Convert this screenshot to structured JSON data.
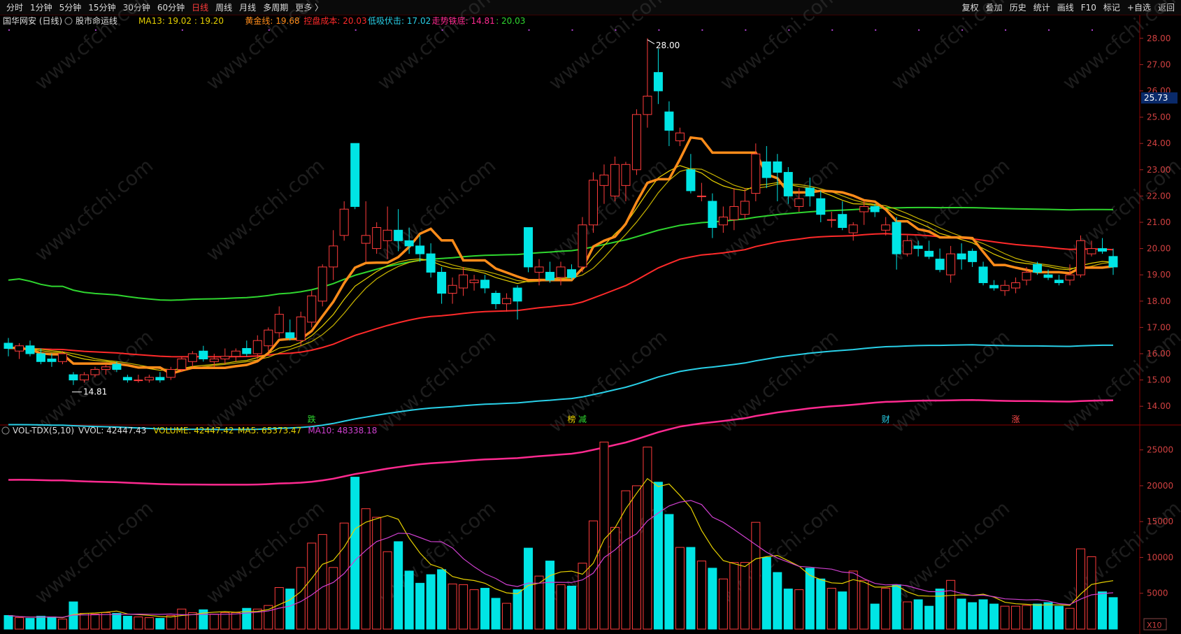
{
  "toolbar": {
    "periods": [
      "分时",
      "1分钟",
      "5分钟",
      "15分钟",
      "30分钟",
      "60分钟",
      "日线",
      "周线",
      "月线",
      "多周期",
      "更多 〉"
    ],
    "active_period": "日线",
    "tools": [
      "复权",
      "叠加",
      "历史",
      "统计",
      "画线",
      "F10",
      "标记",
      "+自选",
      "返回"
    ]
  },
  "main_header": {
    "stock": "国华网安 (日线)",
    "indicator": "股市命运线",
    "items": [
      {
        "label": "MA13: 19.02 : 19.20",
        "color": "#e6d000"
      },
      {
        "label": "黄金线: 19.68",
        "color": "#ff8c1a"
      },
      {
        "label": "控盘成本: 20.03",
        "color": "#ff2a2a"
      },
      {
        "label": "低吸伏击: 17.02",
        "color": "#29d0e8"
      },
      {
        "label": "走势铁底: 14.81",
        "color": "#ff2a90"
      },
      {
        "label": ": 20.03",
        "color": "#2fd62f"
      }
    ]
  },
  "vol_header": {
    "name": "VOL-TDX(5,10)",
    "items": [
      {
        "label": "VVOL: 42447.43",
        "color": "#dddddd"
      },
      {
        "label": "VOLUME: 42447.42",
        "color": "#e6d000"
      },
      {
        "label": "MA5: 65373.47",
        "color": "#e6d000"
      },
      {
        "label": "MA10: 48338.18",
        "color": "#d040d0"
      }
    ]
  },
  "price_axis": [
    "28.00",
    "27.00",
    "26.00",
    "25.00",
    "24.00",
    "23.00",
    "22.00",
    "21.00",
    "20.00",
    "19.00",
    "18.00",
    "17.00",
    "16.00",
    "15.00",
    "14.00"
  ],
  "vol_axis": [
    "25000",
    "20000",
    "15000",
    "10000",
    "5000"
  ],
  "vol_unit": "X10",
  "current_price": "25.73",
  "annotations": {
    "high": "28.00",
    "low": "14.81"
  },
  "events": [
    {
      "text": "跌",
      "index": 28,
      "color": "#2fd62f"
    },
    {
      "text": "榜",
      "index": 52,
      "color": "#e6d000"
    },
    {
      "text": "减",
      "index": 53,
      "color": "#2fd62f"
    },
    {
      "text": "财",
      "index": 81,
      "color": "#29d0e8"
    },
    {
      "text": "涨",
      "index": 93,
      "color": "#ff4a4a"
    }
  ],
  "watermark": "www.cfchi.com",
  "colors": {
    "up": "#ff3c3c",
    "down": "#00e5e5",
    "ma13a": "#e6d000",
    "ma13b": "#e6d000",
    "gold": "#ff8c1a",
    "cost": "#ff2a2a",
    "ambush": "#29d0e8",
    "bottom": "#ff2a90",
    "green": "#2fd62f",
    "vma5": "#e6d000",
    "vma10": "#d040d0"
  },
  "chart_data": {
    "type": "candlestick",
    "candles": [
      [
        16.4,
        16.6,
        15.9,
        16.2
      ],
      [
        16.1,
        16.4,
        15.8,
        16.3
      ],
      [
        16.3,
        16.5,
        15.9,
        16.0
      ],
      [
        16.0,
        16.2,
        15.6,
        15.7
      ],
      [
        15.8,
        16.0,
        15.5,
        15.7
      ],
      [
        15.7,
        16.1,
        15.6,
        16.0
      ],
      [
        15.2,
        15.3,
        14.81,
        15.0
      ],
      [
        15.0,
        15.3,
        14.9,
        15.2
      ],
      [
        15.2,
        15.5,
        15.1,
        15.4
      ],
      [
        15.4,
        15.6,
        15.2,
        15.5
      ],
      [
        15.6,
        15.7,
        15.3,
        15.4
      ],
      [
        15.1,
        15.2,
        14.9,
        15.0
      ],
      [
        15.0,
        15.2,
        14.9,
        15.0
      ],
      [
        15.0,
        15.2,
        14.9,
        15.1
      ],
      [
        15.1,
        15.3,
        14.9,
        15.0
      ],
      [
        15.1,
        15.5,
        15.0,
        15.4
      ],
      [
        15.4,
        15.9,
        15.3,
        15.8
      ],
      [
        15.7,
        16.1,
        15.5,
        16.0
      ],
      [
        16.1,
        16.3,
        15.7,
        15.8
      ],
      [
        15.7,
        16.0,
        15.5,
        15.8
      ],
      [
        15.8,
        16.2,
        15.6,
        15.9
      ],
      [
        15.9,
        16.2,
        15.7,
        16.1
      ],
      [
        16.2,
        16.5,
        15.9,
        16.0
      ],
      [
        16.0,
        16.7,
        15.8,
        16.5
      ],
      [
        16.3,
        17.0,
        16.1,
        16.9
      ],
      [
        16.8,
        17.8,
        16.6,
        17.5
      ],
      [
        16.8,
        17.3,
        16.5,
        16.6
      ],
      [
        16.5,
        17.6,
        16.3,
        17.4
      ],
      [
        17.2,
        18.4,
        17.0,
        18.2
      ],
      [
        18.0,
        19.4,
        17.8,
        19.3
      ],
      [
        19.3,
        20.7,
        18.8,
        20.1
      ],
      [
        20.5,
        21.8,
        20.3,
        21.5
      ],
      [
        24.0,
        24.0,
        21.5,
        21.6
      ],
      [
        20.2,
        21.8,
        19.5,
        20.5
      ],
      [
        20.0,
        21.0,
        19.8,
        20.8
      ],
      [
        20.3,
        21.6,
        19.6,
        20.7
      ],
      [
        20.7,
        21.5,
        19.9,
        20.3
      ],
      [
        20.3,
        20.8,
        19.8,
        20.1
      ],
      [
        20.1,
        20.5,
        19.5,
        19.8
      ],
      [
        19.8,
        20.2,
        18.9,
        19.1
      ],
      [
        19.1,
        19.3,
        17.9,
        18.3
      ],
      [
        18.3,
        18.9,
        17.9,
        18.6
      ],
      [
        18.5,
        19.3,
        18.2,
        19.0
      ],
      [
        18.7,
        19.0,
        18.4,
        18.8
      ],
      [
        18.8,
        19.0,
        18.3,
        18.5
      ],
      [
        18.3,
        18.4,
        17.7,
        17.9
      ],
      [
        17.9,
        18.3,
        17.6,
        18.1
      ],
      [
        18.5,
        18.6,
        17.3,
        18.0
      ],
      [
        20.8,
        20.8,
        19.1,
        19.3
      ],
      [
        19.1,
        19.6,
        18.6,
        19.3
      ],
      [
        19.1,
        19.5,
        18.7,
        18.8
      ],
      [
        18.9,
        19.5,
        18.6,
        19.3
      ],
      [
        19.2,
        19.4,
        18.8,
        18.9
      ],
      [
        19.3,
        21.2,
        19.1,
        20.9
      ],
      [
        20.9,
        22.9,
        20.6,
        22.6
      ],
      [
        22.4,
        23.2,
        21.7,
        22.8
      ],
      [
        22.0,
        23.5,
        21.8,
        23.2
      ],
      [
        22.4,
        23.3,
        21.8,
        23.2
      ],
      [
        23.0,
        25.3,
        22.8,
        25.1
      ],
      [
        25.1,
        28.0,
        24.6,
        25.8
      ],
      [
        26.7,
        27.6,
        25.5,
        26.0
      ],
      [
        25.2,
        25.6,
        23.9,
        24.5
      ],
      [
        24.1,
        24.6,
        23.9,
        24.4
      ],
      [
        23.0,
        23.6,
        22.1,
        22.2
      ],
      [
        22.0,
        22.5,
        21.8,
        22.0
      ],
      [
        21.8,
        22.1,
        20.4,
        20.8
      ],
      [
        20.9,
        21.6,
        20.6,
        21.2
      ],
      [
        21.1,
        22.3,
        20.7,
        21.6
      ],
      [
        21.3,
        22.3,
        21.1,
        21.8
      ],
      [
        22.1,
        24.0,
        21.8,
        23.6
      ],
      [
        23.3,
        23.9,
        22.3,
        22.7
      ],
      [
        23.3,
        23.6,
        21.8,
        22.9
      ],
      [
        22.9,
        23.1,
        21.7,
        22.0
      ],
      [
        21.6,
        22.3,
        21.4,
        21.9
      ],
      [
        22.3,
        22.7,
        21.6,
        22.0
      ],
      [
        21.9,
        22.2,
        21.0,
        21.3
      ],
      [
        21.1,
        21.4,
        20.8,
        21.1
      ],
      [
        21.3,
        21.8,
        20.7,
        20.8
      ],
      [
        20.6,
        21.0,
        20.3,
        20.9
      ],
      [
        21.4,
        21.8,
        20.9,
        21.6
      ],
      [
        21.6,
        21.7,
        21.2,
        21.4
      ],
      [
        20.7,
        21.2,
        20.5,
        20.9
      ],
      [
        21.0,
        21.2,
        19.2,
        19.8
      ],
      [
        19.8,
        20.5,
        19.7,
        20.3
      ],
      [
        20.1,
        20.3,
        19.7,
        20.0
      ],
      [
        19.9,
        20.3,
        19.6,
        19.7
      ],
      [
        19.6,
        20.0,
        19.1,
        19.2
      ],
      [
        19.0,
        20.1,
        18.7,
        19.8
      ],
      [
        19.8,
        20.2,
        19.2,
        19.6
      ],
      [
        19.9,
        20.0,
        19.3,
        19.5
      ],
      [
        19.3,
        19.5,
        18.6,
        18.7
      ],
      [
        18.6,
        18.8,
        18.4,
        18.5
      ],
      [
        18.4,
        18.8,
        18.2,
        18.6
      ],
      [
        18.5,
        18.9,
        18.3,
        18.7
      ],
      [
        18.8,
        19.3,
        18.6,
        19.1
      ],
      [
        19.4,
        19.5,
        19.0,
        19.1
      ],
      [
        19.0,
        19.2,
        18.8,
        18.9
      ],
      [
        18.8,
        19.0,
        18.6,
        18.7
      ],
      [
        18.8,
        19.4,
        18.6,
        19.0
      ],
      [
        19.0,
        20.5,
        18.9,
        20.3
      ],
      [
        19.8,
        20.3,
        19.7,
        20.0
      ],
      [
        20.0,
        20.4,
        19.8,
        19.9
      ],
      [
        19.7,
        20.0,
        19.0,
        19.3
      ]
    ],
    "volume": [
      1900,
      1600,
      1500,
      1800,
      1700,
      1400,
      3800,
      2200,
      2100,
      2300,
      2200,
      1800,
      1700,
      1600,
      1500,
      1900,
      2800,
      2300,
      2700,
      2100,
      2300,
      2300,
      2900,
      2800,
      3300,
      5800,
      5600,
      8600,
      12000,
      13200,
      8600,
      14800,
      21200,
      16800,
      15600,
      10800,
      12200,
      8100,
      6400,
      7600,
      8300,
      6300,
      6200,
      5500,
      5700,
      4300,
      3600,
      5500,
      11300,
      7400,
      9500,
      6200,
      6000,
      9200,
      15100,
      26100,
      14200,
      19300,
      20000,
      25400,
      20500,
      16000,
      11400,
      11400,
      9500,
      8500,
      7000,
      9300,
      9300,
      14900,
      10000,
      7900,
      5600,
      5500,
      8500,
      7000,
      5700,
      5200,
      8100,
      6800,
      3500,
      5700,
      6200,
      3800,
      4100,
      3200,
      5600,
      6800,
      4200,
      3700,
      4100,
      3500,
      3200,
      3200,
      3300,
      3500,
      3700,
      3200,
      2900,
      11200,
      10100,
      5200,
      4400
    ],
    "series": [
      {
        "name": "MA13",
        "values": []
      },
      {
        "name": "黄金线",
        "values": []
      },
      {
        "name": "控盘成本",
        "values": []
      },
      {
        "name": "低吸伏击",
        "values": []
      },
      {
        "name": "走势铁底",
        "values": []
      }
    ],
    "ylim": [
      13.5,
      28.5
    ],
    "vol_ylim": [
      0,
      27500
    ]
  }
}
